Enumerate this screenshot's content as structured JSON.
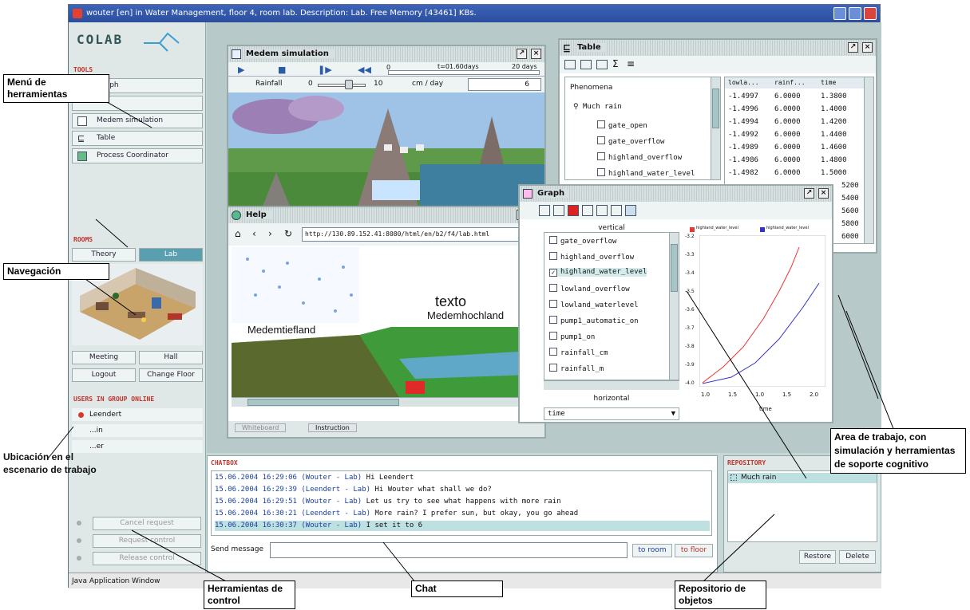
{
  "window": {
    "title": "wouter [en] in Water Management, floor 4, room lab. Description: Lab. Free Memory [43461] KBs."
  },
  "left": {
    "logo": "COLAB",
    "tools_header": "TOOLS",
    "tools": [
      "Graph",
      "",
      "Medem simulation",
      "Table",
      "Process Coordinator"
    ],
    "rooms_header": "ROOMS",
    "room_tabs": [
      "Theory",
      "Lab"
    ],
    "nav_buttons": [
      "Meeting",
      "Hall"
    ],
    "logout": "Logout",
    "change_floor": "Change Floor",
    "users_header": "USERS IN GROUP ONLINE",
    "users": [
      "Leendert",
      "...in",
      "...er"
    ],
    "controls": [
      "Cancel request",
      "Request control",
      "Release control"
    ]
  },
  "medem": {
    "title": "Medem simulation",
    "time_label": "t=01.60days",
    "time_max": "20 days",
    "time_start": "0",
    "rainfall_label": "Rainfall",
    "slider_min": "0",
    "slider_max": "10",
    "unit": "cm / day",
    "value": "6"
  },
  "table": {
    "title": "Table",
    "tree_header": "Phenomena",
    "tree_root": "Much rain",
    "tree_items": [
      "gate_open",
      "gate_overflow",
      "highland_overflow",
      "highland_water_level"
    ],
    "columns": [
      "lowla...",
      "rainf...",
      "time"
    ],
    "rows": [
      [
        "-1.4997",
        "6.0000",
        "1.3800"
      ],
      [
        "-1.4996",
        "6.0000",
        "1.4000"
      ],
      [
        "-1.4994",
        "6.0000",
        "1.4200"
      ],
      [
        "-1.4992",
        "6.0000",
        "1.4400"
      ],
      [
        "-1.4989",
        "6.0000",
        "1.4600"
      ],
      [
        "-1.4986",
        "6.0000",
        "1.4800"
      ],
      [
        "-1.4982",
        "6.0000",
        "1.5000"
      ]
    ],
    "tail_times": [
      "5200",
      "5400",
      "5600",
      "5800",
      "6000"
    ]
  },
  "graph": {
    "title": "Graph",
    "vertical_label": "vertical",
    "horizontal_label": "horizontal",
    "horizontal_value": "time",
    "vars": [
      "gate_overflow",
      "highland_overflow",
      "highland_water_level",
      "lowland_overflow",
      "lowland_waterlevel",
      "pump1_automatic_on",
      "pump1_on",
      "rainfall_cm",
      "rainfall_m"
    ],
    "checked_index": 2,
    "legend": [
      "highland_water_level",
      "highland_water_level"
    ],
    "y_ticks": [
      "-3.2",
      "-3.3",
      "-3.4",
      "-3.5",
      "-3.6",
      "-3.7",
      "-3.8",
      "-3.9",
      "-4.0"
    ],
    "x_ticks": [
      "1.0",
      "1.5",
      "1.0",
      "1.5",
      "2.0"
    ],
    "x_label": "time"
  },
  "help": {
    "title": "Help",
    "url": "http://130.89.152.41:8080/html/en/b2/f4/lab.html",
    "map_labels": [
      "texto",
      "Medemhochland",
      "Medemtiefland"
    ],
    "bottom_tabs": [
      "Whiteboard",
      "Instruction"
    ]
  },
  "chat": {
    "title": "CHATBOX",
    "lines": [
      {
        "ts": "15.06.2004 16:29:06 (Wouter - Lab)",
        "msg": " Hi Leendert"
      },
      {
        "ts": "15.06.2004 16:29:39 (Leendert - Lab)",
        "msg": " Hi Wouter what shall we do?"
      },
      {
        "ts": "15.06.2004 16:29:51 (Wouter - Lab)",
        "msg": " Let us try to see what happens with more rain"
      },
      {
        "ts": "15.06.2004 16:30:21 (Leendert - Lab)",
        "msg": " More rain? I prefer sun, but okay, you go ahead"
      },
      {
        "ts": "15.06.2004 16:30:37 (Wouter - Lab)",
        "msg": " I set it to 6"
      }
    ],
    "send_label": "Send message",
    "to_room": "to room",
    "to_floor": "to floor"
  },
  "repo": {
    "title": "REPOSITORY",
    "item": "Much rain",
    "restore": "Restore",
    "delete": "Delete"
  },
  "statusbar": "Java Application Window",
  "callouts": {
    "menu": "Menú de herramientas",
    "nav": "Navegación",
    "ubicacion": "Ubicación en el escenario de trabajo",
    "area": "Area de trabajo, con simulación y herramientas de soporte cognitivo",
    "control": "Herramientas de control",
    "chat": "Chat",
    "repo": "Repositorio de objetos"
  },
  "colors": {
    "title_blue": "#2b4e9e",
    "accent_teal": "#5a9fb0",
    "header_red": "#c2322a",
    "chat_blue": "#1a3fa5"
  }
}
